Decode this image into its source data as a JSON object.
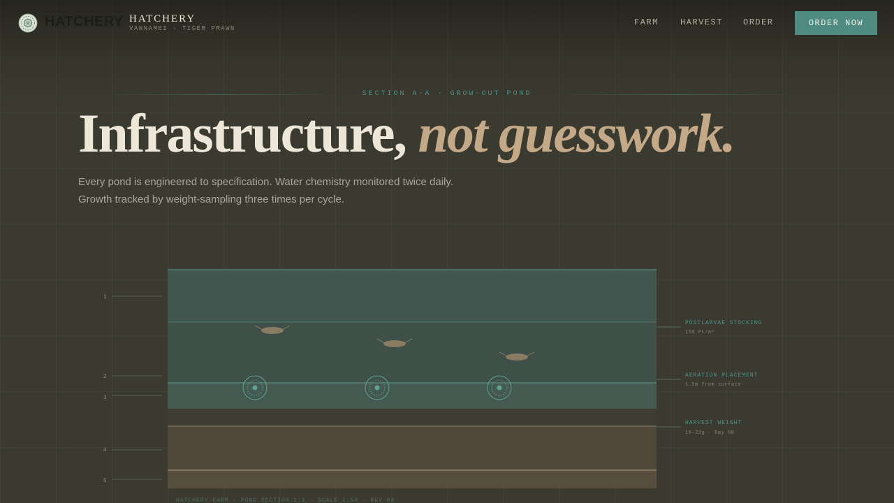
{
  "brand": {
    "logo_word": "HATCHERY",
    "title": "HATCHERY",
    "subtitle": "VANNAMEI · TIGER PRAWN"
  },
  "nav": {
    "links": [
      "FARM",
      "HARVEST",
      "ORDER"
    ],
    "cta": "ORDER NOW"
  },
  "hero": {
    "section_label": "SECTION A-A · GROW-OUT POND",
    "headline_main": "Infrastructure,",
    "headline_accent": "not guesswork.",
    "lede_line1": "Every pond is engineered to specification. Water chemistry monitored twice daily.",
    "lede_line2": "Growth tracked by weight-sampling three times per cycle."
  },
  "diagram": {
    "layer_markers": [
      "1",
      "2",
      "3",
      "4",
      "5"
    ],
    "annotations": [
      {
        "title": "POSTLARVAE STOCKING",
        "detail": "150 PL/m²"
      },
      {
        "title": "AERATION PLACEMENT",
        "detail": "1.5m from surface"
      },
      {
        "title": "HARVEST WEIGHT",
        "detail": "18–22g · Day 90"
      }
    ],
    "footer": "HATCHERY FARM · POND SECTION 1:1 · SCALE 1:50 · REV 04"
  },
  "colors": {
    "background": "#3a3a30",
    "accent_teal": "#4f8b80",
    "accent_tan": "#c4a988",
    "text_light": "#ece7d8"
  },
  "icons": [
    "seal-icon",
    "prawn-icon",
    "aerator-icon"
  ]
}
